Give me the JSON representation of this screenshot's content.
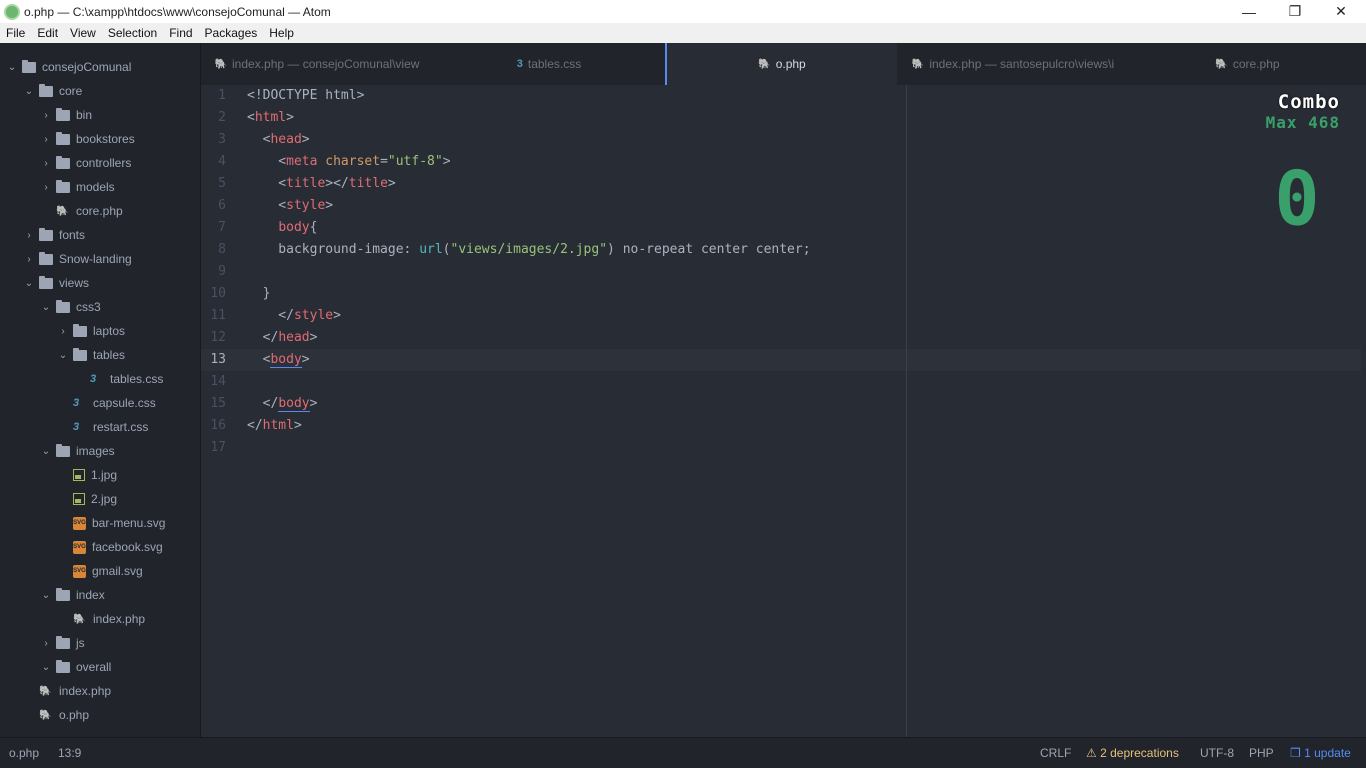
{
  "window": {
    "title": "o.php — C:\\xampp\\htdocs\\www\\consejoComunal — Atom",
    "minimize": "—",
    "restore": "❐",
    "close": "✕"
  },
  "menu": [
    "File",
    "Edit",
    "View",
    "Selection",
    "Find",
    "Packages",
    "Help"
  ],
  "tree": [
    {
      "label": "consejoComunal",
      "type": "folder",
      "open": true
    },
    {
      "label": "core",
      "type": "folder",
      "open": true
    },
    {
      "label": "bin",
      "type": "folder",
      "open": false
    },
    {
      "label": "bookstores",
      "type": "folder",
      "open": false
    },
    {
      "label": "controllers",
      "type": "folder",
      "open": false
    },
    {
      "label": "models",
      "type": "folder",
      "open": false
    },
    {
      "label": "core.php",
      "type": "php"
    },
    {
      "label": "fonts",
      "type": "folder",
      "open": false
    },
    {
      "label": "Snow-landing",
      "type": "folder",
      "open": false
    },
    {
      "label": "views",
      "type": "folder",
      "open": true
    },
    {
      "label": "css3",
      "type": "folder",
      "open": true
    },
    {
      "label": "laptos",
      "type": "folder",
      "open": false
    },
    {
      "label": "tables",
      "type": "folder",
      "open": true
    },
    {
      "label": "tables.css",
      "type": "css"
    },
    {
      "label": "capsule.css",
      "type": "css"
    },
    {
      "label": "restart.css",
      "type": "css"
    },
    {
      "label": "images",
      "type": "folder",
      "open": true
    },
    {
      "label": "1.jpg",
      "type": "image"
    },
    {
      "label": "2.jpg",
      "type": "image"
    },
    {
      "label": "bar-menu.svg",
      "type": "svg"
    },
    {
      "label": "facebook.svg",
      "type": "svg"
    },
    {
      "label": "gmail.svg",
      "type": "svg"
    },
    {
      "label": "index",
      "type": "folder",
      "open": true
    },
    {
      "label": "index.php",
      "type": "php"
    },
    {
      "label": "js",
      "type": "folder",
      "open": false
    },
    {
      "label": "overall",
      "type": "folder",
      "open": true
    },
    {
      "label": "index.php",
      "type": "php"
    },
    {
      "label": "o.php",
      "type": "php"
    }
  ],
  "tabs": [
    {
      "label": "index.php — consejoComunal\\view",
      "icon": "php-elephant-icon"
    },
    {
      "label": "tables.css",
      "icon": "css3-icon"
    },
    {
      "label": "o.php",
      "icon": "php-elephant-icon",
      "active": true
    },
    {
      "label": "index.php — santosepulcro\\views\\i",
      "icon": "php-elephant-icon"
    },
    {
      "label": "core.php",
      "icon": "php-elephant-icon"
    }
  ],
  "editor": {
    "line_numbers": [
      "1",
      "2",
      "3",
      "4",
      "5",
      "6",
      "7",
      "8",
      "9",
      "10",
      "11",
      "12",
      "13",
      "14",
      "15",
      "16",
      "17"
    ],
    "current_line": "13",
    "lines": [
      [
        {
          "t": "<!DOCTYPE html>",
          "c": "plain"
        }
      ],
      [
        {
          "t": "<",
          "c": "plain"
        },
        {
          "t": "html",
          "c": "tag"
        },
        {
          "t": ">",
          "c": "plain"
        }
      ],
      [
        {
          "t": "  <",
          "c": "plain"
        },
        {
          "t": "head",
          "c": "tag"
        },
        {
          "t": ">",
          "c": "plain"
        }
      ],
      [
        {
          "t": "    <",
          "c": "plain"
        },
        {
          "t": "meta",
          "c": "tag"
        },
        {
          "t": " ",
          "c": "plain"
        },
        {
          "t": "charset",
          "c": "attr"
        },
        {
          "t": "=",
          "c": "plain"
        },
        {
          "t": "\"utf-8\"",
          "c": "str"
        },
        {
          "t": ">",
          "c": "plain"
        }
      ],
      [
        {
          "t": "    <",
          "c": "plain"
        },
        {
          "t": "title",
          "c": "tag"
        },
        {
          "t": "></",
          "c": "plain"
        },
        {
          "t": "title",
          "c": "tag"
        },
        {
          "t": ">",
          "c": "plain"
        }
      ],
      [
        {
          "t": "    <",
          "c": "plain"
        },
        {
          "t": "style",
          "c": "tag"
        },
        {
          "t": ">",
          "c": "plain"
        }
      ],
      [
        {
          "t": "    ",
          "c": "plain"
        },
        {
          "t": "body",
          "c": "tag"
        },
        {
          "t": "{",
          "c": "plain"
        }
      ],
      [
        {
          "t": "    background-image: ",
          "c": "plain"
        },
        {
          "t": "url",
          "c": "fn"
        },
        {
          "t": "(",
          "c": "plain"
        },
        {
          "t": "\"views/images/2.jpg\"",
          "c": "str"
        },
        {
          "t": ") no-repeat center center;",
          "c": "plain"
        }
      ],
      [
        {
          "t": "",
          "c": "plain"
        }
      ],
      [
        {
          "t": "  }",
          "c": "plain"
        }
      ],
      [
        {
          "t": "    </",
          "c": "plain"
        },
        {
          "t": "style",
          "c": "tag"
        },
        {
          "t": ">",
          "c": "plain"
        }
      ],
      [
        {
          "t": "  </",
          "c": "plain"
        },
        {
          "t": "head",
          "c": "tag"
        },
        {
          "t": ">",
          "c": "plain"
        }
      ],
      [
        {
          "t": "  <",
          "c": "plain"
        },
        {
          "t": "body",
          "c": "tag",
          "u": true
        },
        {
          "t": ">",
          "c": "plain"
        }
      ],
      [
        {
          "t": "",
          "c": "plain"
        }
      ],
      [
        {
          "t": "  </",
          "c": "plain"
        },
        {
          "t": "body",
          "c": "tag",
          "u": true
        },
        {
          "t": ">",
          "c": "plain"
        }
      ],
      [
        {
          "t": "</",
          "c": "plain"
        },
        {
          "t": "html",
          "c": "tag"
        },
        {
          "t": ">",
          "c": "plain"
        }
      ],
      [
        {
          "t": "",
          "c": "plain"
        }
      ]
    ]
  },
  "combo": {
    "title": "Combo",
    "max_text": "Max 468",
    "count": "0",
    "color": "#3aa06b"
  },
  "status": {
    "file": "o.php",
    "cursor": "13:9",
    "line_ending": "CRLF",
    "deprecations": "2 deprecations",
    "encoding": "UTF-8",
    "grammar": "PHP",
    "update": "1 update"
  },
  "colors": {
    "accent": "#568af2",
    "tag": "#e06c75",
    "attr": "#d19a66",
    "string": "#98c379",
    "function": "#56b6c2"
  }
}
